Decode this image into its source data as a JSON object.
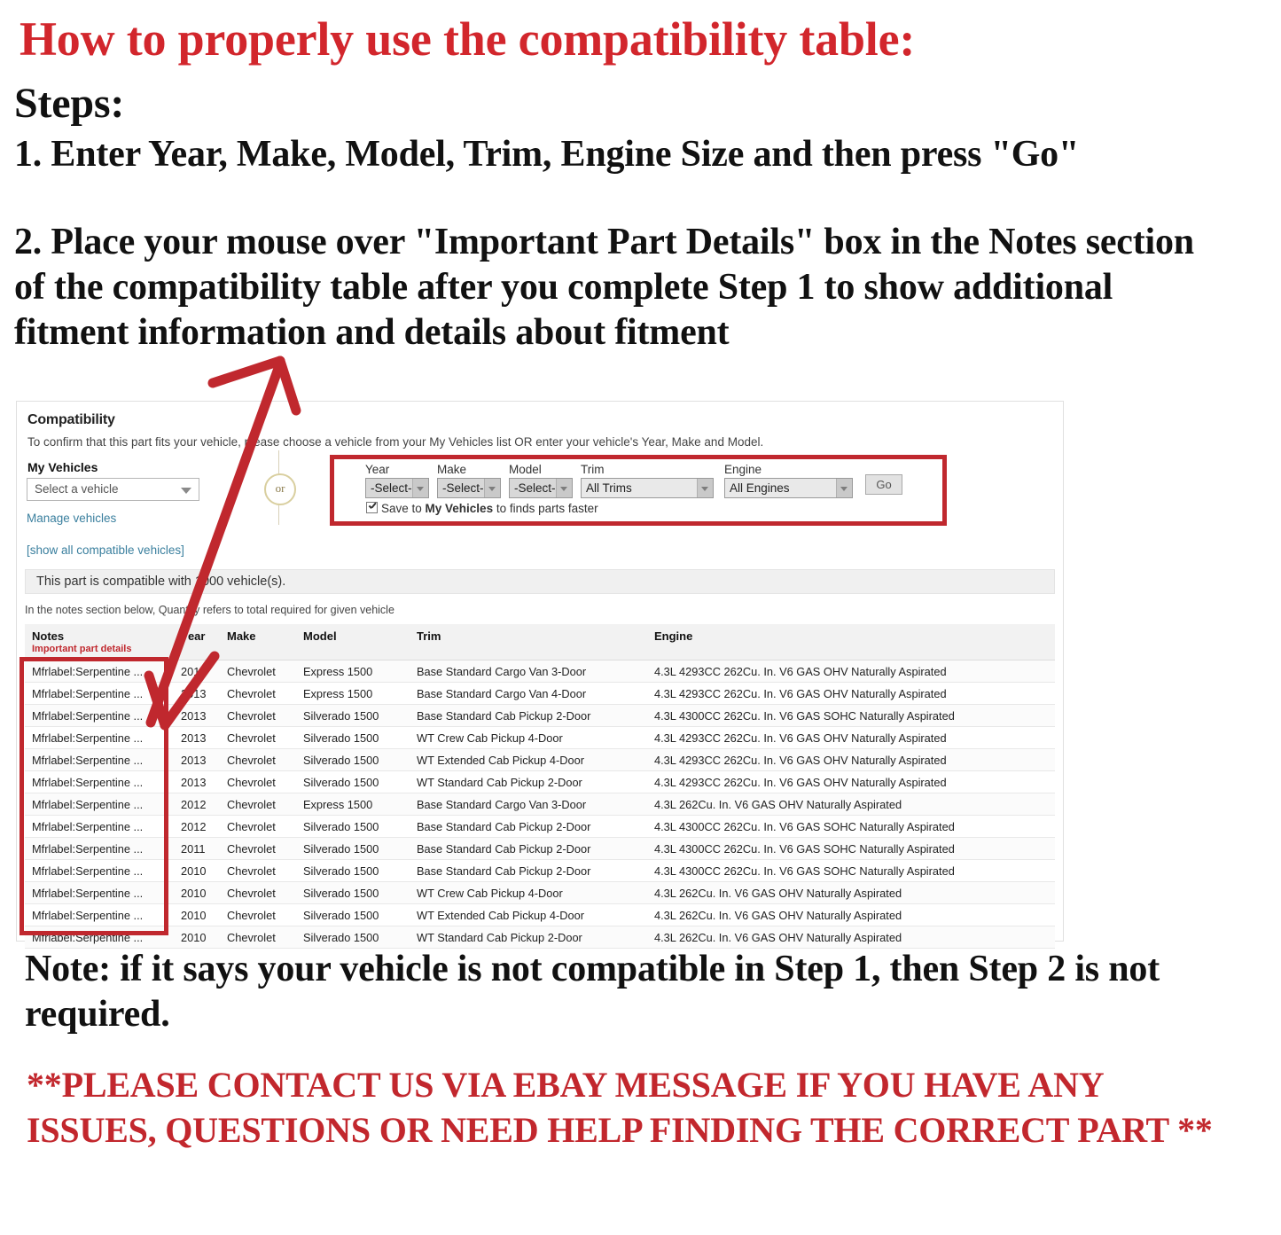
{
  "instructions": {
    "title": "How to properly use the compatibility table:",
    "steps_label": "Steps:",
    "step_1": "1. Enter Year, Make, Model, Trim, Engine Size and then press \"Go\"",
    "step_2": "2. Place your mouse over \"Important Part Details\" box in the Notes section of the compatibility table after you complete Step 1 to show additional fitment information and details about fitment",
    "note": "Note: if it says your vehicle is not compatible in Step 1, then Step 2 is not required.",
    "contact": "**PLEASE CONTACT US VIA EBAY MESSAGE IF YOU HAVE ANY ISSUES, QUESTIONS OR NEED HELP FINDING THE CORRECT PART **"
  },
  "colors": {
    "accent_red": "#D2262C",
    "highlight_box_red": "#C0282E",
    "link_blue": "#3a7f9e",
    "note_red": "#C0282E"
  },
  "compatibility": {
    "title": "Compatibility",
    "subtitle": "To confirm that this part fits your vehicle, please choose a vehicle from your My Vehicles list OR enter your vehicle's Year, Make and Model.",
    "my_vehicles": {
      "label": "My Vehicles",
      "select_value": "Select a vehicle",
      "manage_link": "Manage vehicles",
      "show_all_link": "[show all compatible vehicles]"
    },
    "or_label": "or",
    "finder": {
      "year": {
        "label": "Year",
        "value": "-Select-"
      },
      "make": {
        "label": "Make",
        "value": "-Select-"
      },
      "model": {
        "label": "Model",
        "value": "-Select-"
      },
      "trim": {
        "label": "Trim",
        "value": "All Trims"
      },
      "engine": {
        "label": "Engine",
        "value": "All Engines"
      },
      "go_button": "Go",
      "save_text_pre": "Save to ",
      "save_text_bold": "My Vehicles",
      "save_text_post": " to finds parts faster"
    },
    "result_banner": "This part is compatible with 1000 vehicle(s).",
    "quantity_note": "In the notes section below, Quantity refers to total required for given vehicle",
    "table": {
      "headers": {
        "notes": "Notes",
        "notes_sub": "Important part details",
        "year": "Year",
        "make": "Make",
        "model": "Model",
        "trim": "Trim",
        "engine": "Engine"
      },
      "rows": [
        {
          "notes": "Mfrlabel:Serpentine ...",
          "year": "2013",
          "make": "Chevrolet",
          "model": "Express 1500",
          "trim": "Base Standard Cargo Van 3-Door",
          "engine": "4.3L 4293CC 262Cu. In. V6 GAS OHV Naturally Aspirated"
        },
        {
          "notes": "Mfrlabel:Serpentine ...",
          "year": "2013",
          "make": "Chevrolet",
          "model": "Express 1500",
          "trim": "Base Standard Cargo Van 4-Door",
          "engine": "4.3L 4293CC 262Cu. In. V6 GAS OHV Naturally Aspirated"
        },
        {
          "notes": "Mfrlabel:Serpentine ...",
          "year": "2013",
          "make": "Chevrolet",
          "model": "Silverado 1500",
          "trim": "Base Standard Cab Pickup 2-Door",
          "engine": "4.3L 4300CC 262Cu. In. V6 GAS SOHC Naturally Aspirated"
        },
        {
          "notes": "Mfrlabel:Serpentine ...",
          "year": "2013",
          "make": "Chevrolet",
          "model": "Silverado 1500",
          "trim": "WT Crew Cab Pickup 4-Door",
          "engine": "4.3L 4293CC 262Cu. In. V6 GAS OHV Naturally Aspirated"
        },
        {
          "notes": "Mfrlabel:Serpentine ...",
          "year": "2013",
          "make": "Chevrolet",
          "model": "Silverado 1500",
          "trim": "WT Extended Cab Pickup 4-Door",
          "engine": "4.3L 4293CC 262Cu. In. V6 GAS OHV Naturally Aspirated"
        },
        {
          "notes": "Mfrlabel:Serpentine ...",
          "year": "2013",
          "make": "Chevrolet",
          "model": "Silverado 1500",
          "trim": "WT Standard Cab Pickup 2-Door",
          "engine": "4.3L 4293CC 262Cu. In. V6 GAS OHV Naturally Aspirated"
        },
        {
          "notes": "Mfrlabel:Serpentine ...",
          "year": "2012",
          "make": "Chevrolet",
          "model": "Express 1500",
          "trim": "Base Standard Cargo Van 3-Door",
          "engine": "4.3L 262Cu. In. V6 GAS OHV Naturally Aspirated"
        },
        {
          "notes": "Mfrlabel:Serpentine ...",
          "year": "2012",
          "make": "Chevrolet",
          "model": "Silverado 1500",
          "trim": "Base Standard Cab Pickup 2-Door",
          "engine": "4.3L 4300CC 262Cu. In. V6 GAS SOHC Naturally Aspirated"
        },
        {
          "notes": "Mfrlabel:Serpentine ...",
          "year": "2011",
          "make": "Chevrolet",
          "model": "Silverado 1500",
          "trim": "Base Standard Cab Pickup 2-Door",
          "engine": "4.3L 4300CC 262Cu. In. V6 GAS SOHC Naturally Aspirated"
        },
        {
          "notes": "Mfrlabel:Serpentine ...",
          "year": "2010",
          "make": "Chevrolet",
          "model": "Silverado 1500",
          "trim": "Base Standard Cab Pickup 2-Door",
          "engine": "4.3L 4300CC 262Cu. In. V6 GAS SOHC Naturally Aspirated"
        },
        {
          "notes": "Mfrlabel:Serpentine ...",
          "year": "2010",
          "make": "Chevrolet",
          "model": "Silverado 1500",
          "trim": "WT Crew Cab Pickup 4-Door",
          "engine": "4.3L 262Cu. In. V6 GAS OHV Naturally Aspirated"
        },
        {
          "notes": "Mfrlabel:Serpentine ...",
          "year": "2010",
          "make": "Chevrolet",
          "model": "Silverado 1500",
          "trim": "WT Extended Cab Pickup 4-Door",
          "engine": "4.3L 262Cu. In. V6 GAS OHV Naturally Aspirated"
        },
        {
          "notes": "Mfrlabel:Serpentine ...",
          "year": "2010",
          "make": "Chevrolet",
          "model": "Silverado 1500",
          "trim": "WT Standard Cab Pickup 2-Door",
          "engine": "4.3L 262Cu. In. V6 GAS OHV Naturally Aspirated"
        }
      ]
    }
  }
}
